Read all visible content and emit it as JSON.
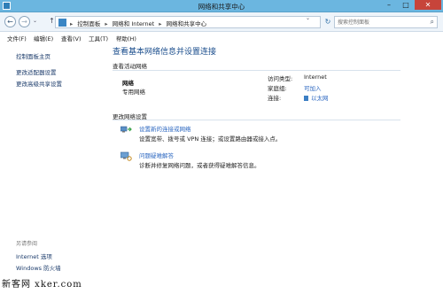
{
  "window": {
    "title": "网络和共享中心",
    "buttons": {
      "minimize": "–",
      "maximize": "□",
      "close": "✕"
    }
  },
  "address": {
    "back_glyph": "←",
    "forward_glyph": "→",
    "recent_glyph": "⌄",
    "up_glyph": "↑",
    "breadcrumbs": [
      "控制面板",
      "网络和 Internet",
      "网络和共享中心"
    ],
    "separator": "▸",
    "dropdown_glyph": "⌄",
    "refresh_glyph": "↻",
    "search_placeholder": "搜索控制面板",
    "search_glyph": "⌕"
  },
  "menu": [
    "文件(F)",
    "编辑(E)",
    "查看(V)",
    "工具(T)",
    "帮助(H)"
  ],
  "sidebar": {
    "home": "控制面板主页",
    "links": [
      "更改适配器设置",
      "更改高级共享设置"
    ],
    "see_also_heading": "另请参阅",
    "see_also": [
      "Internet 选项",
      "Windows 防火墙"
    ]
  },
  "main": {
    "title": "查看基本网络信息并设置连接",
    "active_heading": "查看活动网络",
    "network": {
      "name": "网络",
      "type": "专用网络",
      "props": [
        {
          "label": "访问类型:",
          "value": "Internet",
          "link": false
        },
        {
          "label": "家庭组:",
          "value": "可加入",
          "link": true
        },
        {
          "label": "连接:",
          "value": "以太网",
          "link": true
        }
      ]
    },
    "settings_heading": "更改网络设置",
    "tasks": [
      {
        "link": "设置新的连接或网络",
        "desc": "设置宽带、拨号或 VPN 连接；或设置路由器或接入点。",
        "icon": "network-setup-icon"
      },
      {
        "link": "问题疑难解答",
        "desc": "诊断并修复网络问题，或者获得疑难解答信息。",
        "icon": "troubleshoot-icon"
      }
    ]
  },
  "watermark": "新客网 xker.com"
}
